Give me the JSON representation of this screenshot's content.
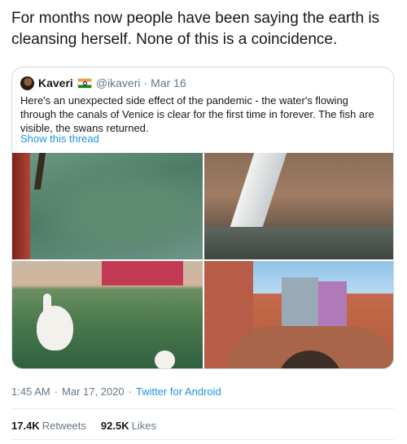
{
  "tweet": {
    "text": "For months now people have been saying the earth is cleansing herself. None of this is a coincidence.",
    "time": "1:45 AM",
    "date": "Mar 17, 2020",
    "source": "Twitter for Android",
    "separator": "·"
  },
  "quoted": {
    "name": "Kaveri",
    "handle": "@ikaveri",
    "date": "Mar 16",
    "separator": "·",
    "text": "Here's an unexpected side effect of the pandemic - the water's flowing through the canals of Venice is clear for the first time in forever. The fish are visible, the swans returned.",
    "show_thread": "Show this thread"
  },
  "stats": {
    "retweets_count": "17.4K",
    "retweets_label": "Retweets",
    "likes_count": "92.5K",
    "likes_label": "Likes"
  },
  "colors": {
    "link": "#1b95e0",
    "muted": "#657786",
    "text": "#14171a",
    "border": "#cfd9de"
  },
  "icons": [
    "avatar",
    "india-flag-icon"
  ]
}
